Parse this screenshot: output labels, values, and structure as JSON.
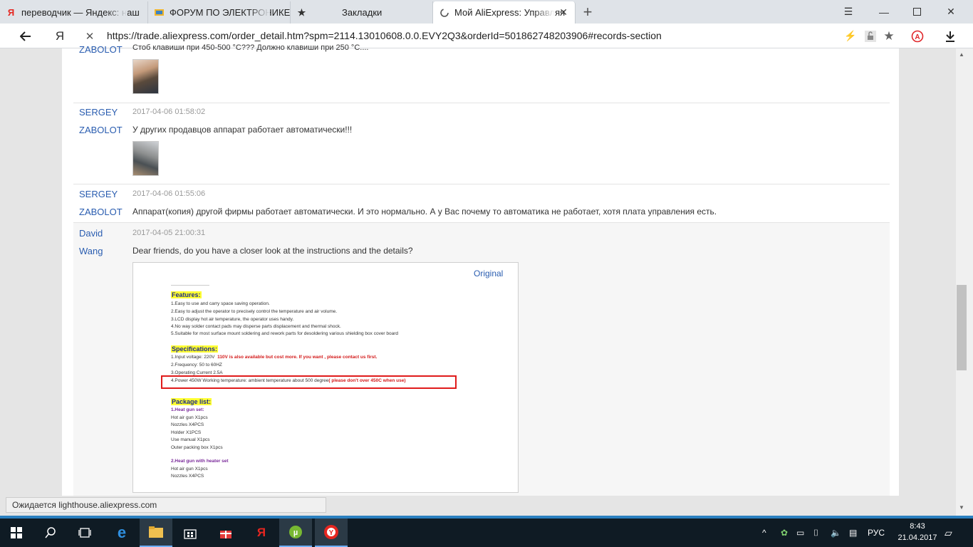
{
  "browser": {
    "tabs": [
      {
        "label": "переводчик — Яндекс: наш",
        "icon": "yandex-icon"
      },
      {
        "label": "ФОРУМ ПО ЭЛЕКТРОНИКЕ",
        "icon": "forum-icon"
      },
      {
        "label": "Закладки",
        "icon": "star-icon"
      },
      {
        "label": "Мой AliExpress: Управляя",
        "icon": "loading-icon"
      }
    ],
    "url": "https://trade.aliexpress.com/order_detail.htm?spm=2114.13010608.0.0.EVY2Q3&orderId=501862748203906#records-section",
    "status": "Ожидается lighthouse.aliexpress.com"
  },
  "records": {
    "top_partial": {
      "name": "ZABOLOT",
      "message": "Стоб клавиши при 450-500 °C??? Должно клавиши при 250 °С...."
    },
    "items": [
      {
        "name_line1": "SERGEY",
        "name_line2": "ZABOLOT",
        "date": "2017-04-06 01:58:02",
        "message": "У других продавцов аппарат работает автоматически!!!"
      },
      {
        "name_line1": "SERGEY",
        "name_line2": "ZABOLOT",
        "date": "2017-04-06 01:55:06",
        "message": "Аппарат(копия) другой фирмы работает автоматически. И это нормально. А у Вас почему то автоматика не работает, хотя плата управления есть."
      },
      {
        "name_line1": "David",
        "name_line2": "Wang",
        "date": "2017-04-05 21:00:31",
        "message": "Dear friends, do you have a closer look at the instructions and the details?"
      }
    ],
    "original_link": "Original"
  },
  "attachment": {
    "features_title": "Features:",
    "features": [
      "1.Easy to use and carry space saving operation.",
      "2.Easy to adjust the operator to precisely control the temperature and air volume.",
      "3.LCD display hot air temperature, the operator uses handy.",
      "4.No way solder contact pads may disperse parts displacement and thermal shock.",
      "5.Suitable for most surface mount soldering and rework parts for desoldering various shielding box cover board"
    ],
    "specs_title": "Specifications:",
    "spec1": "1.Input voltage: 220V",
    "spec1_red": "110V is also available but cost more. If you want , please contact us first.",
    "spec2": "2.Frequency: 50 to 60HZ",
    "spec3": "3.Operating Current 2.5A",
    "spec4": "4.Power 450W Working temperature: ambient temperature about 500 degree",
    "spec4_red": "( please don't over 450C when use)",
    "package_title": "Package list:",
    "set1_title": "1.Heat gun set:",
    "set1": [
      "Hot air gun  X1pcs",
      "Nozzles       X4PCS",
      "Holder        X1PCS",
      "Use manual X1pcs",
      "Outer packing box  X1pcs"
    ],
    "set2_title": "2.Heat gun with heater set",
    "set2": [
      "Hot air gun  X1pcs",
      "Nozzles       X4PCS"
    ]
  },
  "taskbar": {
    "language": "РУС",
    "time": "8:43",
    "date": "21.04.2017"
  }
}
